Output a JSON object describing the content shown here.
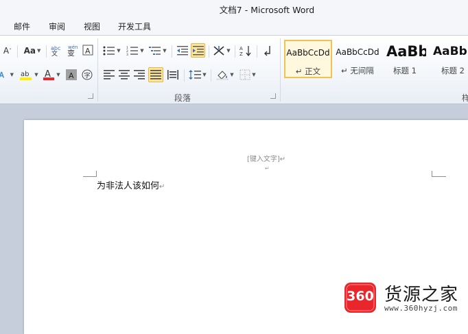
{
  "window": {
    "title": "文档7  -  Microsoft Word"
  },
  "menu": {
    "tabs": [
      "邮件",
      "审阅",
      "视图",
      "开发工具"
    ]
  },
  "ribbon": {
    "font_group": {
      "font_size_button": "Aa",
      "shrink_label": "A",
      "font_color_label": "A",
      "char_shade_label": "A"
    },
    "paragraph_group": {
      "label": "段落"
    },
    "styles_group": {
      "label_partial": "样",
      "styles": [
        {
          "sample": "AaBbCcDd",
          "name": "↵ 正文",
          "selected": true
        },
        {
          "sample": "AaBbCcDd",
          "name": "↵ 无间隔",
          "selected": false
        },
        {
          "sample": "AaBb",
          "name": "标题 1",
          "selected": false
        },
        {
          "sample": "AaBb",
          "name": "标题 2",
          "selected": false
        }
      ]
    }
  },
  "document": {
    "header_placeholder": "[键入文字]↵",
    "header_mark": "↵",
    "body_text": "为非法人该如何",
    "paragraph_mark": "↵"
  },
  "watermark": {
    "logo_text": "360",
    "name": "货源之家",
    "url": "www.360hyzj.com"
  },
  "colors": {
    "accent_red": "#e8262b",
    "highlight_yellow": "#ffee00",
    "active_gold": "#fde69b"
  }
}
